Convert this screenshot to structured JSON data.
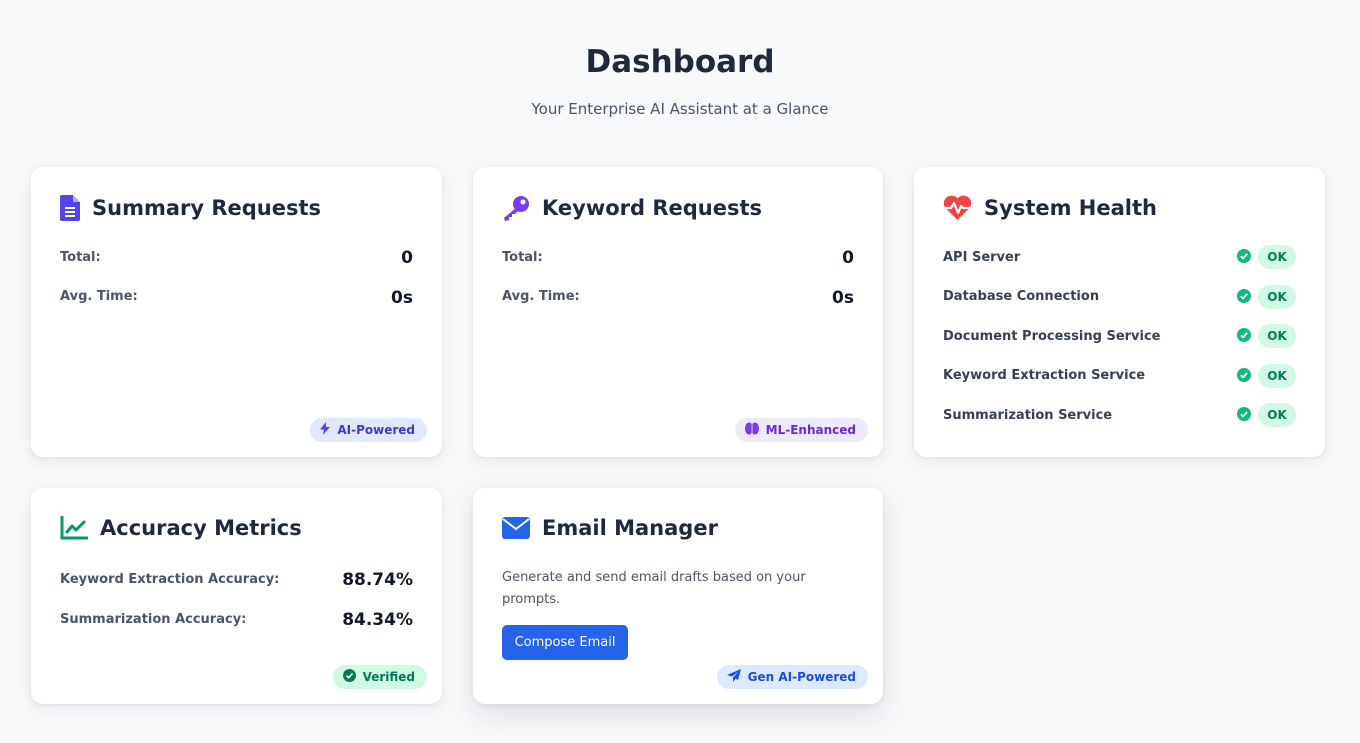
{
  "header": {
    "title": "Dashboard",
    "subtitle": "Your Enterprise AI Assistant at a Glance"
  },
  "summary": {
    "title": "Summary Requests",
    "icon": "document-icon",
    "total_label": "Total:",
    "total_value": "0",
    "avg_label": "Avg. Time:",
    "avg_value": "0s",
    "badge": "AI-Powered"
  },
  "keyword": {
    "title": "Keyword Requests",
    "icon": "key-icon",
    "total_label": "Total:",
    "total_value": "0",
    "avg_label": "Avg. Time:",
    "avg_value": "0s",
    "badge": "ML-Enhanced"
  },
  "health": {
    "title": "System Health",
    "icon": "heartbeat-icon",
    "services": [
      {
        "name": "API Server",
        "status": "OK"
      },
      {
        "name": "Database Connection",
        "status": "OK"
      },
      {
        "name": "Document Processing Service",
        "status": "OK"
      },
      {
        "name": "Keyword Extraction Service",
        "status": "OK"
      },
      {
        "name": "Summarization Service",
        "status": "OK"
      }
    ]
  },
  "accuracy": {
    "title": "Accuracy Metrics",
    "icon": "line-chart-icon",
    "keyword_label": "Keyword Extraction Accuracy:",
    "keyword_value": "88.74%",
    "summ_label": "Summarization Accuracy:",
    "summ_value": "84.34%",
    "badge": "Verified"
  },
  "email": {
    "title": "Email Manager",
    "icon": "envelope-icon",
    "description": "Generate and send email drafts based on your prompts.",
    "button": "Compose Email",
    "badge": "Gen AI-Powered"
  },
  "colors": {
    "background": "#f8f9fb",
    "primary_blue": "#2563eb",
    "purple": "#6d28d9",
    "indigo": "#4f46e5",
    "red": "#ef4444",
    "green": "#10b981",
    "teal": "#059669"
  }
}
